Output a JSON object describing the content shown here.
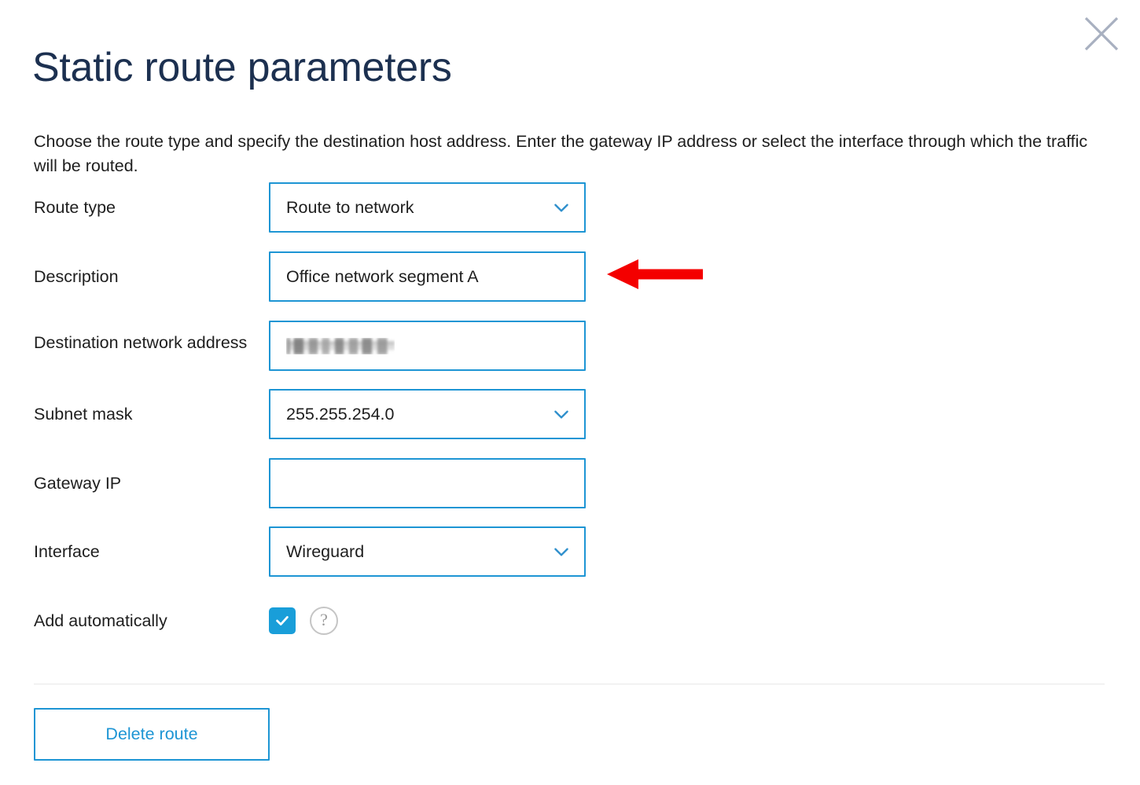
{
  "dialog": {
    "title": "Static route parameters",
    "description": "Choose the route type and specify the destination host address. Enter the gateway IP address or select the interface through which the traffic will be routed.",
    "close_label": "×"
  },
  "colors": {
    "accent_blue": "#1d95d4",
    "checkbox_blue": "#199ed9",
    "title_navy": "#1c3050",
    "annotation_red": "#f40000",
    "divider_gray": "#e8e8e8",
    "help_icon_gray": "#c5c5c5"
  },
  "fields": [
    {
      "label": "Route type",
      "kind": "select",
      "value": "Route to network",
      "placeholder": "",
      "icon": "chevron-down-icon",
      "name": "route-type"
    },
    {
      "label": "Description",
      "kind": "input",
      "value": "Office network segment A",
      "placeholder": "",
      "icon": "",
      "name": "description"
    },
    {
      "label": "Destination network address",
      "kind": "input-redacted",
      "value": "",
      "placeholder": "",
      "icon": "",
      "name": "destination-network-address"
    },
    {
      "label": "Subnet mask",
      "kind": "select",
      "value": "255.255.254.0",
      "placeholder": "",
      "icon": "chevron-down-icon",
      "name": "subnet-mask"
    },
    {
      "label": "Gateway IP",
      "kind": "input",
      "value": "",
      "placeholder": "",
      "icon": "",
      "name": "gateway-ip"
    },
    {
      "label": "Interface",
      "kind": "select",
      "value": "Wireguard",
      "placeholder": "",
      "icon": "chevron-down-icon",
      "name": "interface"
    }
  ],
  "checkbox_row": {
    "label": "Add automatically",
    "checked": true,
    "help_glyph": "?"
  },
  "actions": {
    "delete_label": "Delete route"
  },
  "annotation": {
    "type": "arrow",
    "direction": "left",
    "points_to": "Description"
  }
}
